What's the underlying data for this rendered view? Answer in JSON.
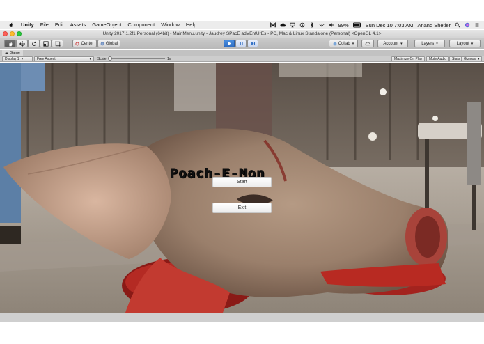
{
  "menubar": {
    "items": [
      "Unity",
      "File",
      "Edit",
      "Assets",
      "GameObject",
      "Component",
      "Window",
      "Help"
    ],
    "battery": "99%",
    "datetime": "Sun Dec 10  7:03 AM",
    "user": "Anand Shetler"
  },
  "window": {
    "title": "Unity 2017.1.2f1 Personal (64bit) - MainMenu.unity - Jaudrey SPacE adVEntUrEs - PC, Mac & Linux Standalone (Personal) <OpenGL 4.1>"
  },
  "toolbar": {
    "pivot_label": "Center",
    "space_label": "Global",
    "collab_label": "Collab",
    "account_label": "Account",
    "layers_label": "Layers",
    "layout_label": "Layout"
  },
  "game_view": {
    "tab_label": "Game",
    "display_label": "Display 1",
    "aspect_label": "Free Aspect",
    "scale_label": "Scale",
    "scale_value": "1x",
    "maximize_label": "Maximize On Play",
    "mute_label": "Mute Audio",
    "stats_label": "Stats",
    "gizmos_label": "Gizmos"
  },
  "game": {
    "title": "Poach-E-Mon",
    "start_label": "Start",
    "exit_label": "Exit"
  },
  "colors": {
    "accent_play": "#3a7fd5",
    "menubar_bg": "#ececec",
    "toolbar_bg": "#c2c2c2"
  }
}
